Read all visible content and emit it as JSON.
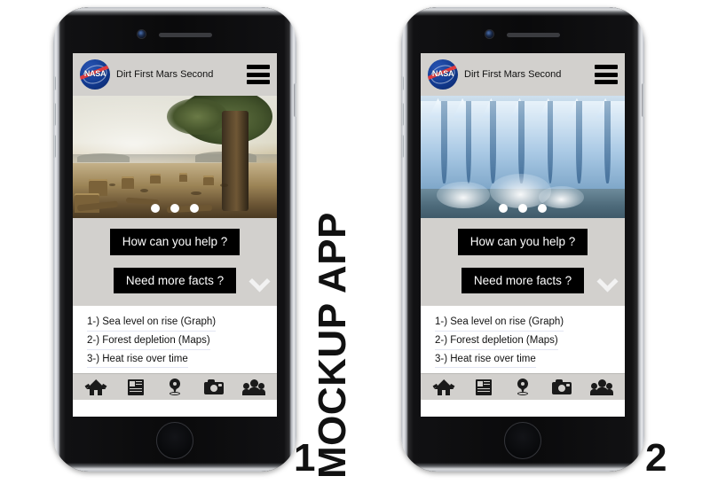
{
  "poster": {
    "label_left": "MOCKUP APP",
    "label_right": "MOCKUP APP",
    "number_one": "1",
    "number_two": "2"
  },
  "app": {
    "header": {
      "logo_text": "NASA",
      "logo_name": "nasa-logo",
      "title": "Dirt First Mars Second",
      "menu_icon": "hamburger-menu-icon"
    },
    "carousel": {
      "dot_count": 3,
      "slide_one_alt": "deforestation-clearcut-with-lone-tree",
      "slide_two_alt": "glacier-calving-into-water"
    },
    "actions": {
      "help_label": "How can you help ?",
      "facts_label": "Need more facts ?",
      "expand_icon": "chevron-down-icon"
    },
    "facts": [
      "1-) Sea level on rise (Graph)",
      "2-) Forest depletion (Maps)",
      "3-) Heat rise over time"
    ],
    "tabs": [
      {
        "name": "home",
        "icon": "home-icon"
      },
      {
        "name": "news",
        "icon": "news-document-icon"
      },
      {
        "name": "map",
        "icon": "location-pin-icon"
      },
      {
        "name": "camera",
        "icon": "camera-icon"
      },
      {
        "name": "community",
        "icon": "people-group-icon"
      }
    ]
  },
  "colors": {
    "panel_grey": "#d2d0cd",
    "button_black": "#000000",
    "nasa_blue": "#123a8f",
    "nasa_red": "#e03a3e",
    "dot_white": "#ffffff"
  }
}
